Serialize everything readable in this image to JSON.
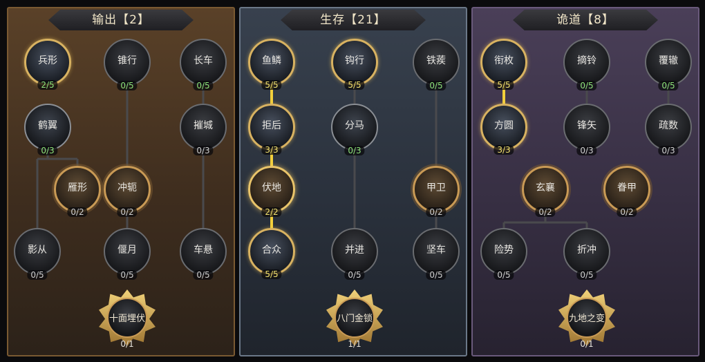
{
  "panels": [
    {
      "title": "输出【2】",
      "bg": "#4a3724",
      "nodes": [
        {
          "name": "兵形",
          "count": "2/5",
          "style": "act",
          "cc": "g"
        },
        {
          "name": "锥行",
          "count": "0/5",
          "style": "dark",
          "cc": "g"
        },
        {
          "name": "长车",
          "count": "0/5",
          "style": "dark",
          "cc": "g"
        },
        {
          "name": "鹤翼",
          "count": "0/3",
          "style": "partial",
          "cc": "g"
        },
        {
          "name": "摧城",
          "count": "0/3",
          "style": "dark",
          "cc": ""
        },
        {
          "name": "雁形",
          "count": "0/2",
          "style": "gold",
          "cc": ""
        },
        {
          "name": "冲轭",
          "count": "0/2",
          "style": "gold",
          "cc": ""
        },
        {
          "name": "影从",
          "count": "0/5",
          "style": "dark",
          "cc": ""
        },
        {
          "name": "偃月",
          "count": "0/5",
          "style": "dark",
          "cc": ""
        },
        {
          "name": "车悬",
          "count": "0/5",
          "style": "dark",
          "cc": ""
        }
      ],
      "ult": {
        "name": "十面埋伏",
        "count": "0/1"
      }
    },
    {
      "title": "生存【21】",
      "bg": "#2b3340",
      "nodes": [
        {
          "name": "鱼鳞",
          "count": "5/5",
          "style": "act",
          "cc": "y"
        },
        {
          "name": "钩行",
          "count": "5/5",
          "style": "act",
          "cc": "y"
        },
        {
          "name": "铁蒺",
          "count": "0/5",
          "style": "dark",
          "cc": "g"
        },
        {
          "name": "拒后",
          "count": "3/3",
          "style": "act",
          "cc": "y"
        },
        {
          "name": "分马",
          "count": "0/3",
          "style": "partial",
          "cc": "g"
        },
        {
          "name": "伏地",
          "count": "2/2",
          "style": "gold lit",
          "cc": "y"
        },
        {
          "name": "甲卫",
          "count": "0/2",
          "style": "gold",
          "cc": ""
        },
        {
          "name": "合众",
          "count": "5/5",
          "style": "act",
          "cc": "y"
        },
        {
          "name": "并进",
          "count": "0/5",
          "style": "dark",
          "cc": ""
        },
        {
          "name": "坚车",
          "count": "0/5",
          "style": "dark",
          "cc": ""
        }
      ],
      "ult": {
        "name": "八门金锁",
        "count": "1/1"
      }
    },
    {
      "title": "诡道【8】",
      "bg": "#3b3346",
      "nodes": [
        {
          "name": "衔枚",
          "count": "5/5",
          "style": "act",
          "cc": "y"
        },
        {
          "name": "摘铃",
          "count": "0/5",
          "style": "dark",
          "cc": "g"
        },
        {
          "name": "覆辙",
          "count": "0/5",
          "style": "dark",
          "cc": "g"
        },
        {
          "name": "方圆",
          "count": "3/3",
          "style": "act",
          "cc": "y"
        },
        {
          "name": "锋矢",
          "count": "0/3",
          "style": "dark",
          "cc": ""
        },
        {
          "name": "疏数",
          "count": "0/3",
          "style": "dark",
          "cc": ""
        },
        {
          "name": "玄襄",
          "count": "0/2",
          "style": "gold",
          "cc": ""
        },
        {
          "name": "眷甲",
          "count": "0/2",
          "style": "gold",
          "cc": ""
        },
        {
          "name": "险势",
          "count": "0/5",
          "style": "dark",
          "cc": ""
        },
        {
          "name": "折冲",
          "count": "0/5",
          "style": "dark",
          "cc": ""
        }
      ],
      "ult": {
        "name": "九地之变",
        "count": "0/1"
      }
    }
  ],
  "colors": {
    "active_line": "#f2cf3b",
    "inactive_line": "#4a4a4d",
    "border_left": "#7a5a32",
    "border_mid": "#6b7888",
    "border_right": "#6a5a7c"
  }
}
